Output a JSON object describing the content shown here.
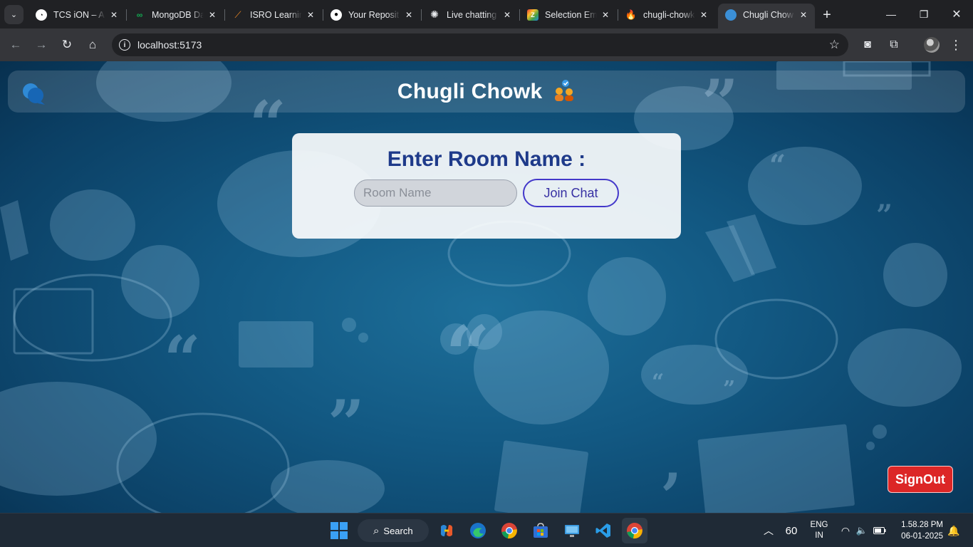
{
  "browser": {
    "tabs": [
      {
        "title": "TCS iON – A",
        "icon": "tcs-ion-icon"
      },
      {
        "title": "MongoDB Da",
        "icon": "mongodb-leaf-icon"
      },
      {
        "title": "ISRO Learnin",
        "icon": "isro-icon"
      },
      {
        "title": "Your Reposit",
        "icon": "github-icon"
      },
      {
        "title": "Live chatting",
        "icon": "openai-icon"
      },
      {
        "title": "Selection Em",
        "icon": "selection-icon"
      },
      {
        "title": "chugli-chowk",
        "icon": "firebase-icon"
      },
      {
        "title": "Chugli Chow",
        "icon": "chat-bubble-icon"
      }
    ],
    "url": "localhost:5173"
  },
  "app": {
    "title": "Chugli Chowk",
    "heading": "Enter Room Name :",
    "room_input": {
      "placeholder": "Room Name",
      "value": ""
    },
    "join_label": "Join Chat",
    "signout_label": "SignOut"
  },
  "taskbar": {
    "search_label": "Search",
    "apps": [
      "windows-start-icon",
      "copilot-icon",
      "edge-icon",
      "chrome-icon",
      "store-icon",
      "remote-desktop-icon",
      "vscode-icon",
      "chrome-icon"
    ],
    "tray": {
      "number": "60",
      "lang_top": "ENG",
      "lang_bottom": "IN",
      "time": "1.58.28 PM",
      "date": "06-01-2025"
    }
  },
  "colors": {
    "heading": "#1e3a8a",
    "join_border": "#4338ca",
    "signout_bg": "#dc2626",
    "page_bg": "#125882"
  }
}
